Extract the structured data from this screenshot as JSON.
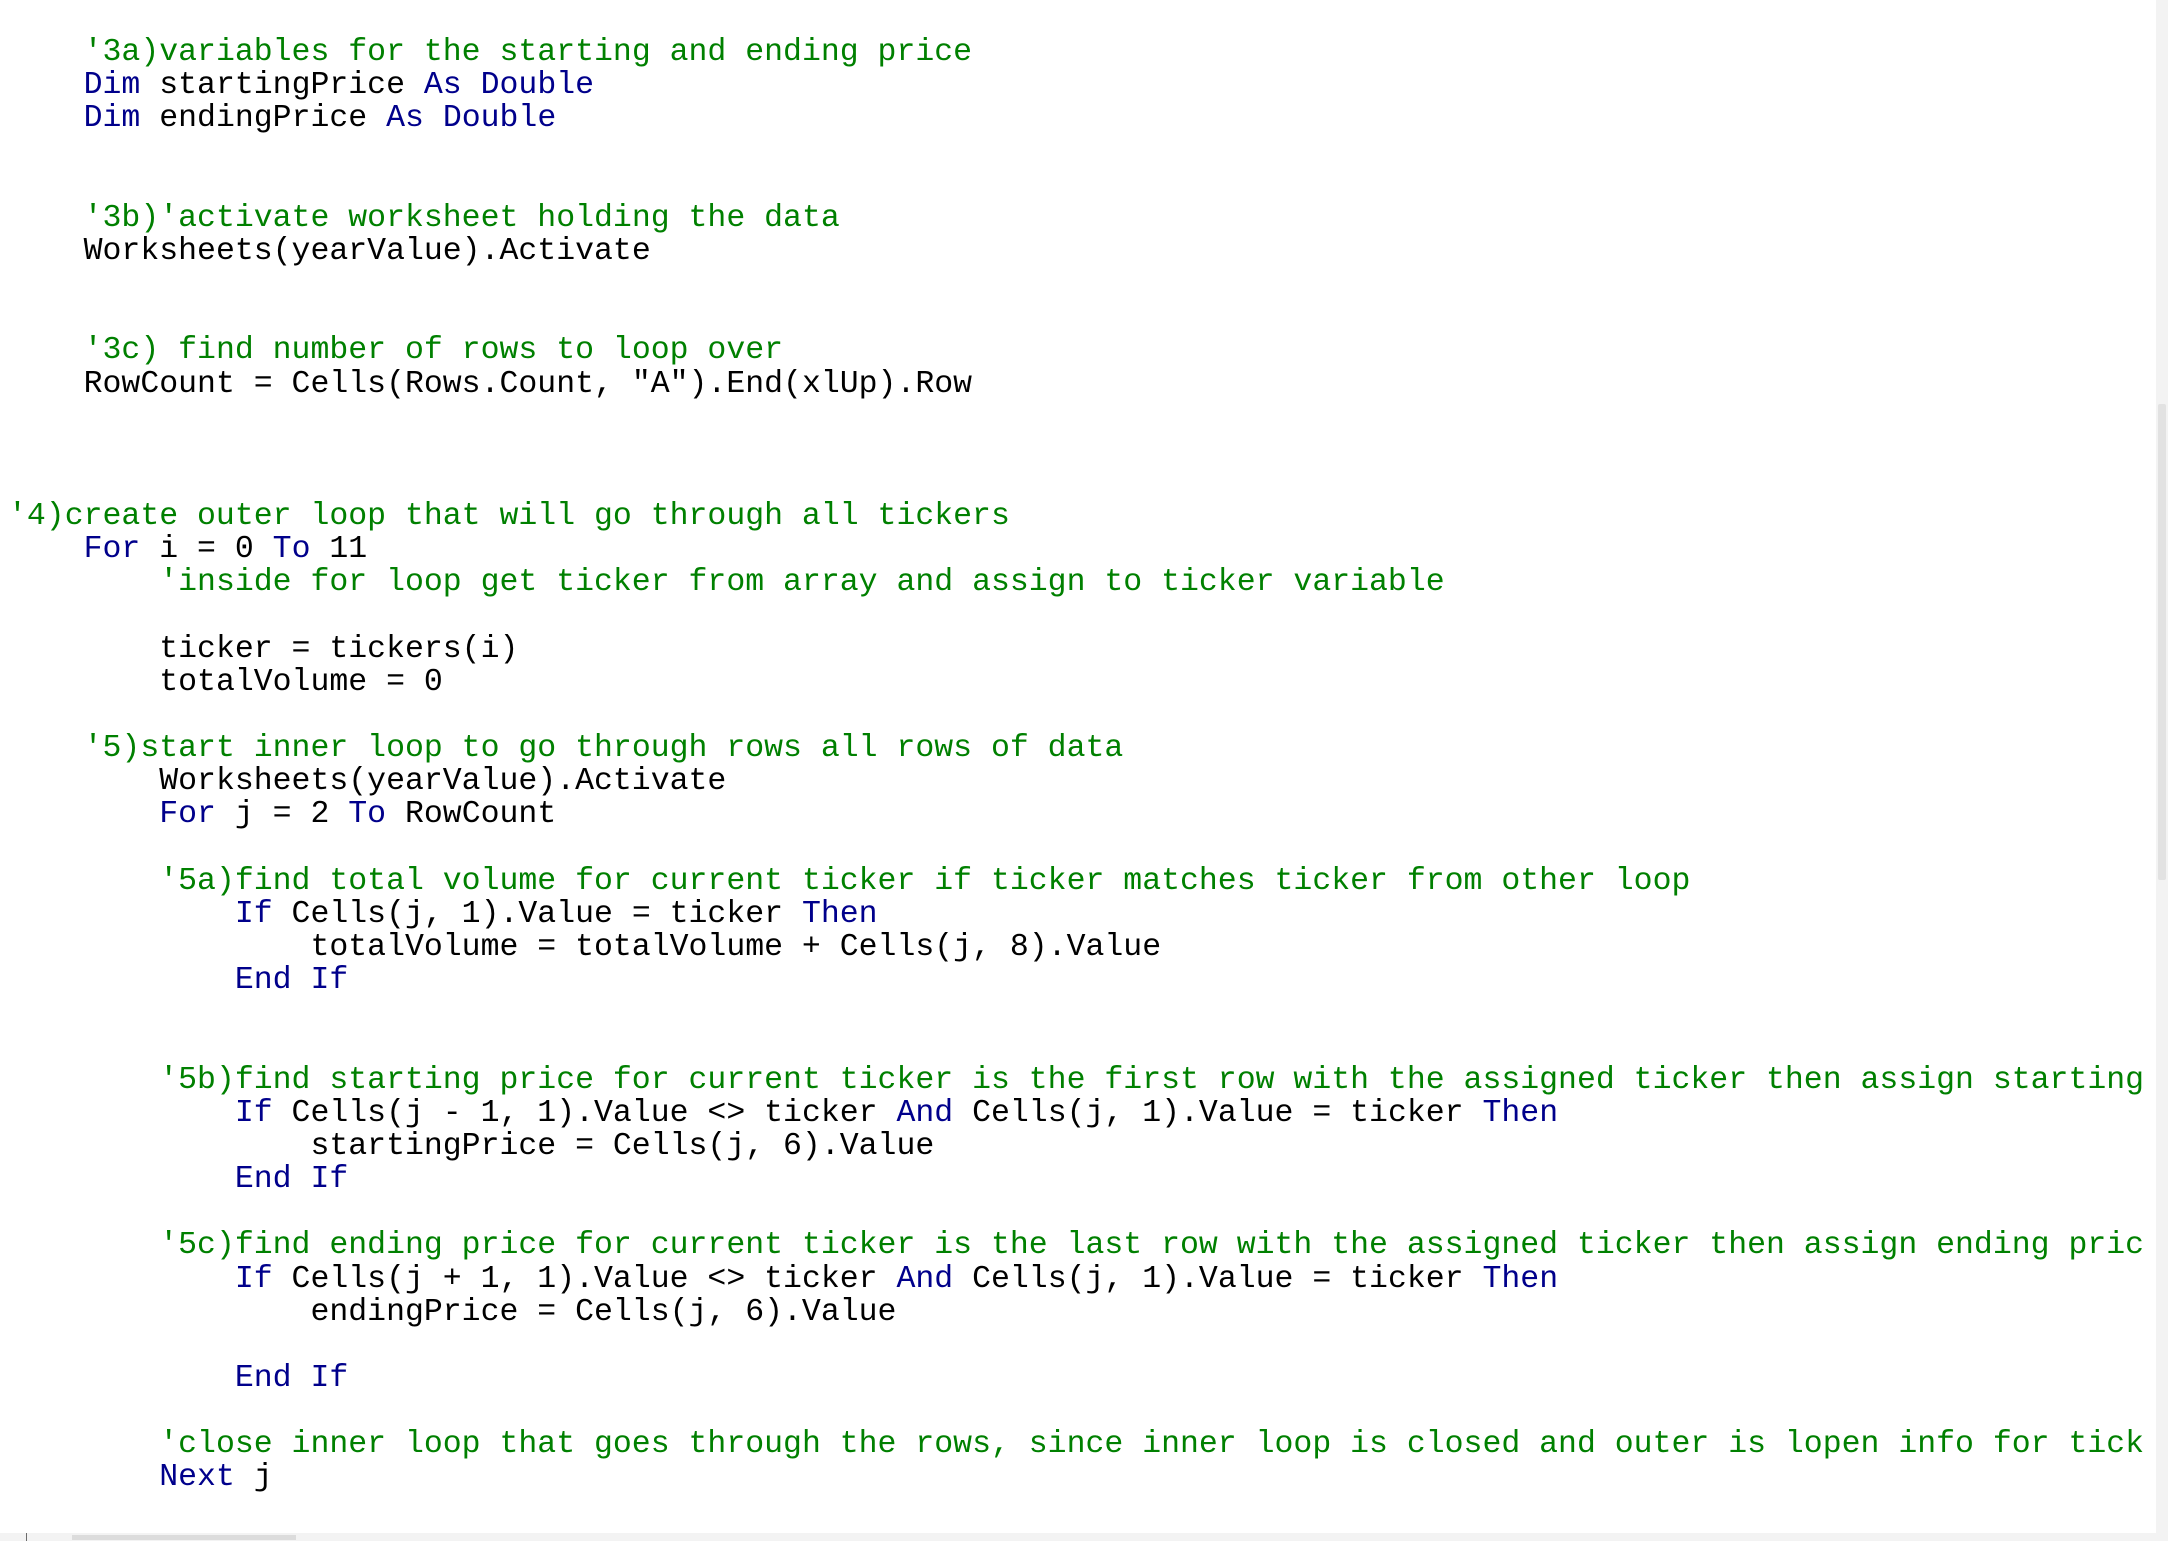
{
  "code": {
    "lines": [
      {
        "indent": "    ",
        "tokens": [
          {
            "text": "'3a)variables for the starting and ending price",
            "kind": "comment"
          }
        ]
      },
      {
        "indent": "    ",
        "tokens": [
          {
            "text": "Dim",
            "kind": "keyword"
          },
          {
            "text": " startingPrice ",
            "kind": "plain"
          },
          {
            "text": "As",
            "kind": "keyword"
          },
          {
            "text": " ",
            "kind": "plain"
          },
          {
            "text": "Double",
            "kind": "keyword"
          }
        ]
      },
      {
        "indent": "    ",
        "tokens": [
          {
            "text": "Dim",
            "kind": "keyword"
          },
          {
            "text": " endingPrice ",
            "kind": "plain"
          },
          {
            "text": "As",
            "kind": "keyword"
          },
          {
            "text": " ",
            "kind": "plain"
          },
          {
            "text": "Double",
            "kind": "keyword"
          }
        ]
      },
      {
        "indent": "",
        "tokens": []
      },
      {
        "indent": "",
        "tokens": []
      },
      {
        "indent": "    ",
        "tokens": [
          {
            "text": "'3b)'activate worksheet holding the data",
            "kind": "comment"
          }
        ]
      },
      {
        "indent": "    ",
        "tokens": [
          {
            "text": "Worksheets(yearValue).Activate",
            "kind": "plain"
          }
        ]
      },
      {
        "indent": "",
        "tokens": []
      },
      {
        "indent": "",
        "tokens": []
      },
      {
        "indent": "    ",
        "tokens": [
          {
            "text": "'3c) find number of rows to loop over",
            "kind": "comment"
          }
        ]
      },
      {
        "indent": "    ",
        "tokens": [
          {
            "text": "RowCount = Cells(Rows.Count, \"A\").End(xlUp).Row",
            "kind": "plain"
          }
        ]
      },
      {
        "indent": "",
        "tokens": []
      },
      {
        "indent": "",
        "tokens": []
      },
      {
        "indent": "",
        "tokens": []
      },
      {
        "indent": "",
        "tokens": [
          {
            "text": "'4)create outer loop that will go through all tickers",
            "kind": "comment"
          }
        ]
      },
      {
        "indent": "    ",
        "tokens": [
          {
            "text": "For",
            "kind": "keyword"
          },
          {
            "text": " i = 0 ",
            "kind": "plain"
          },
          {
            "text": "To",
            "kind": "keyword"
          },
          {
            "text": " 11",
            "kind": "plain"
          }
        ]
      },
      {
        "indent": "        ",
        "tokens": [
          {
            "text": "'inside for loop get ticker from array and assign to ticker variable",
            "kind": "comment"
          }
        ]
      },
      {
        "indent": "",
        "tokens": []
      },
      {
        "indent": "        ",
        "tokens": [
          {
            "text": "ticker = tickers(i)",
            "kind": "plain"
          }
        ]
      },
      {
        "indent": "        ",
        "tokens": [
          {
            "text": "totalVolume = 0",
            "kind": "plain"
          }
        ]
      },
      {
        "indent": "",
        "tokens": []
      },
      {
        "indent": "    ",
        "tokens": [
          {
            "text": "'5)start inner loop to go through rows all rows of data",
            "kind": "comment"
          }
        ]
      },
      {
        "indent": "        ",
        "tokens": [
          {
            "text": "Worksheets(yearValue).Activate",
            "kind": "plain"
          }
        ]
      },
      {
        "indent": "        ",
        "tokens": [
          {
            "text": "For",
            "kind": "keyword"
          },
          {
            "text": " j = 2 ",
            "kind": "plain"
          },
          {
            "text": "To",
            "kind": "keyword"
          },
          {
            "text": " RowCount",
            "kind": "plain"
          }
        ]
      },
      {
        "indent": "",
        "tokens": []
      },
      {
        "indent": "        ",
        "tokens": [
          {
            "text": "'5a)find total volume for current ticker if ticker matches ticker from other loop",
            "kind": "comment"
          }
        ]
      },
      {
        "indent": "            ",
        "tokens": [
          {
            "text": "If",
            "kind": "keyword"
          },
          {
            "text": " Cells(j, 1).Value = ticker ",
            "kind": "plain"
          },
          {
            "text": "Then",
            "kind": "keyword"
          }
        ]
      },
      {
        "indent": "                ",
        "tokens": [
          {
            "text": "totalVolume = totalVolume + Cells(j, 8).Value",
            "kind": "plain"
          }
        ]
      },
      {
        "indent": "            ",
        "tokens": [
          {
            "text": "End If",
            "kind": "keyword"
          }
        ]
      },
      {
        "indent": "",
        "tokens": []
      },
      {
        "indent": "",
        "tokens": []
      },
      {
        "indent": "        ",
        "tokens": [
          {
            "text": "'5b)find starting price for current ticker is the first row with the assigned ticker then assign starting",
            "kind": "comment"
          }
        ]
      },
      {
        "indent": "            ",
        "tokens": [
          {
            "text": "If",
            "kind": "keyword"
          },
          {
            "text": " Cells(j - 1, 1).Value <> ticker ",
            "kind": "plain"
          },
          {
            "text": "And",
            "kind": "keyword"
          },
          {
            "text": " Cells(j, 1).Value = ticker ",
            "kind": "plain"
          },
          {
            "text": "Then",
            "kind": "keyword"
          }
        ]
      },
      {
        "indent": "                ",
        "tokens": [
          {
            "text": "startingPrice = Cells(j, 6).Value",
            "kind": "plain"
          }
        ]
      },
      {
        "indent": "            ",
        "tokens": [
          {
            "text": "End If",
            "kind": "keyword"
          }
        ]
      },
      {
        "indent": "",
        "tokens": []
      },
      {
        "indent": "        ",
        "tokens": [
          {
            "text": "'5c)find ending price for current ticker is the last row with the assigned ticker then assign ending pric",
            "kind": "comment"
          }
        ]
      },
      {
        "indent": "            ",
        "tokens": [
          {
            "text": "If",
            "kind": "keyword"
          },
          {
            "text": " Cells(j + 1, 1).Value <> ticker ",
            "kind": "plain"
          },
          {
            "text": "And",
            "kind": "keyword"
          },
          {
            "text": " Cells(j, 1).Value = ticker ",
            "kind": "plain"
          },
          {
            "text": "Then",
            "kind": "keyword"
          }
        ]
      },
      {
        "indent": "                ",
        "tokens": [
          {
            "text": "endingPrice = Cells(j, 6).Value",
            "kind": "plain"
          }
        ]
      },
      {
        "indent": "",
        "tokens": []
      },
      {
        "indent": "            ",
        "tokens": [
          {
            "text": "End If",
            "kind": "keyword"
          }
        ]
      },
      {
        "indent": "",
        "tokens": []
      },
      {
        "indent": "        ",
        "tokens": [
          {
            "text": "'close inner loop that goes through the rows, since inner loop is closed and outer is lopen info for tick",
            "kind": "comment"
          }
        ]
      },
      {
        "indent": "        ",
        "tokens": [
          {
            "text": "Next",
            "kind": "keyword"
          },
          {
            "text": " j",
            "kind": "plain"
          }
        ]
      }
    ]
  },
  "colors": {
    "comment": "#008000",
    "keyword": "#00008b",
    "plain": "#000000",
    "background": "#ffffff"
  }
}
